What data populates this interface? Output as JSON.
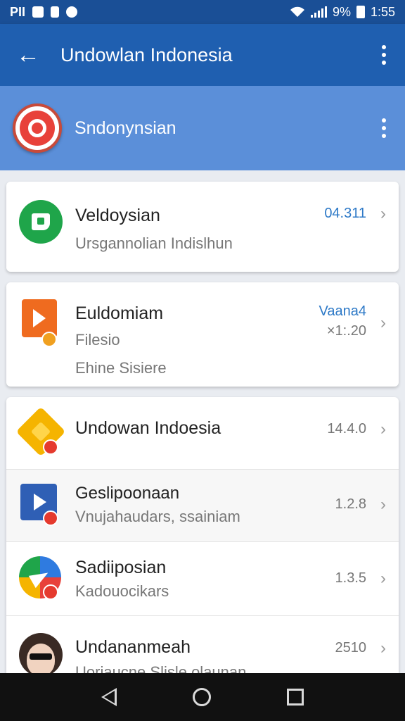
{
  "status_bar": {
    "left_text": "PII",
    "signal_text": "9%",
    "time": "1:55",
    "icons": [
      "image-icon",
      "lock-icon",
      "circle-icon",
      "wifi-icon",
      "signal-icon",
      "battery-icon"
    ]
  },
  "app_bar": {
    "title": "Undowlan Indonesia",
    "back_icon": "←"
  },
  "header": {
    "name": "Sndonynsian"
  },
  "cards": [
    {
      "title": "Veldoysian",
      "subtitle": "Ursgannolian Indislhun",
      "version": "04.311",
      "icon": "green-shield-icon"
    },
    {
      "title": "Euldomiam",
      "line2": "Filesio",
      "line3": "Ehine Sisiere",
      "version_top": "Vaana4",
      "version_bottom": "×1:.20",
      "icon": "orange-play-icon"
    }
  ],
  "list": [
    {
      "title": "Undowan Indoesia",
      "subtitle": "",
      "version": "14.4.0",
      "icon": "yellow-gem-icon"
    },
    {
      "title": "Geslipoonaan",
      "subtitle": "Vnujahaudars, ssainiam",
      "version": "1.2.8",
      "icon": "blue-video-icon"
    },
    {
      "title": "Sadiiposian",
      "subtitle": "Kadouocikars",
      "version": "1.3.5",
      "icon": "paper-plane-icon"
    },
    {
      "title": "Undananmeah",
      "subtitle": "Uoriaucne Slisle olaunan",
      "version": "2510",
      "icon": "avatar-icon"
    }
  ],
  "chevron": "›",
  "colors": {
    "status_bar": "#1a4f96",
    "app_bar": "#1f5fb0",
    "header": "#5b8fd9",
    "accent_blue": "#2d79c7"
  }
}
